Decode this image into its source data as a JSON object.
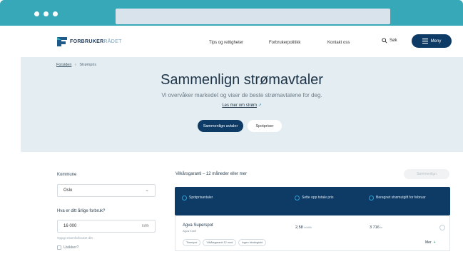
{
  "browser": {
    "accent": "#36a8b8"
  },
  "nav": {
    "logo_bold": "FORBRUKER",
    "logo_light": "RÅDET",
    "links": [
      "Tips og rettigheter",
      "Forbrukerpolitikk",
      "Kontakt oss"
    ],
    "search_label": "Søk",
    "menu_label": "Meny"
  },
  "hero": {
    "breadcrumb_home": "Forsiden",
    "breadcrumb_sep": "›",
    "breadcrumb_current": "Strømpris",
    "title": "Sammenlign strømavtaler",
    "subtitle": "Vi overvåker markedet og viser de beste strømavtalene for deg.",
    "read_more": "Les mer om strøm",
    "btn_compare": "Sammenlign avtaler",
    "btn_spot": "Spotpriser"
  },
  "filters": {
    "municipality_label": "Kommune",
    "municipality_value": "Oslo",
    "usage_label": "Hva er ditt årlige forbruk?",
    "usage_value": "16 000",
    "usage_unit": "kWh",
    "usage_hint": "Oppgi strømforbruket ditt",
    "unsure_label": "Usikker?"
  },
  "results": {
    "section_title": "Vilkårsgaranti – 12 måneder eller mer",
    "sort_label": "Sammenlign",
    "headers": [
      "Spotprisavtaler",
      "Sette opp totale pris",
      "Beregnet strømutgift for februar"
    ],
    "rows": [
      {
        "company": "Agva Superspot",
        "supplier": "Agva Kraft",
        "price": "2,58",
        "price_unit": "kr/kWh",
        "monthly": "3 716",
        "monthly_unit": "kr",
        "tags": [
          "Timespot",
          "Vilkårsgaranti 12 mnd",
          "Ingen bindingstid"
        ],
        "more_label": "Mer"
      }
    ]
  },
  "colors": {
    "navy": "#0d3b66",
    "hero_bg": "#e4edf1",
    "link_blue": "#2b9fd3"
  }
}
